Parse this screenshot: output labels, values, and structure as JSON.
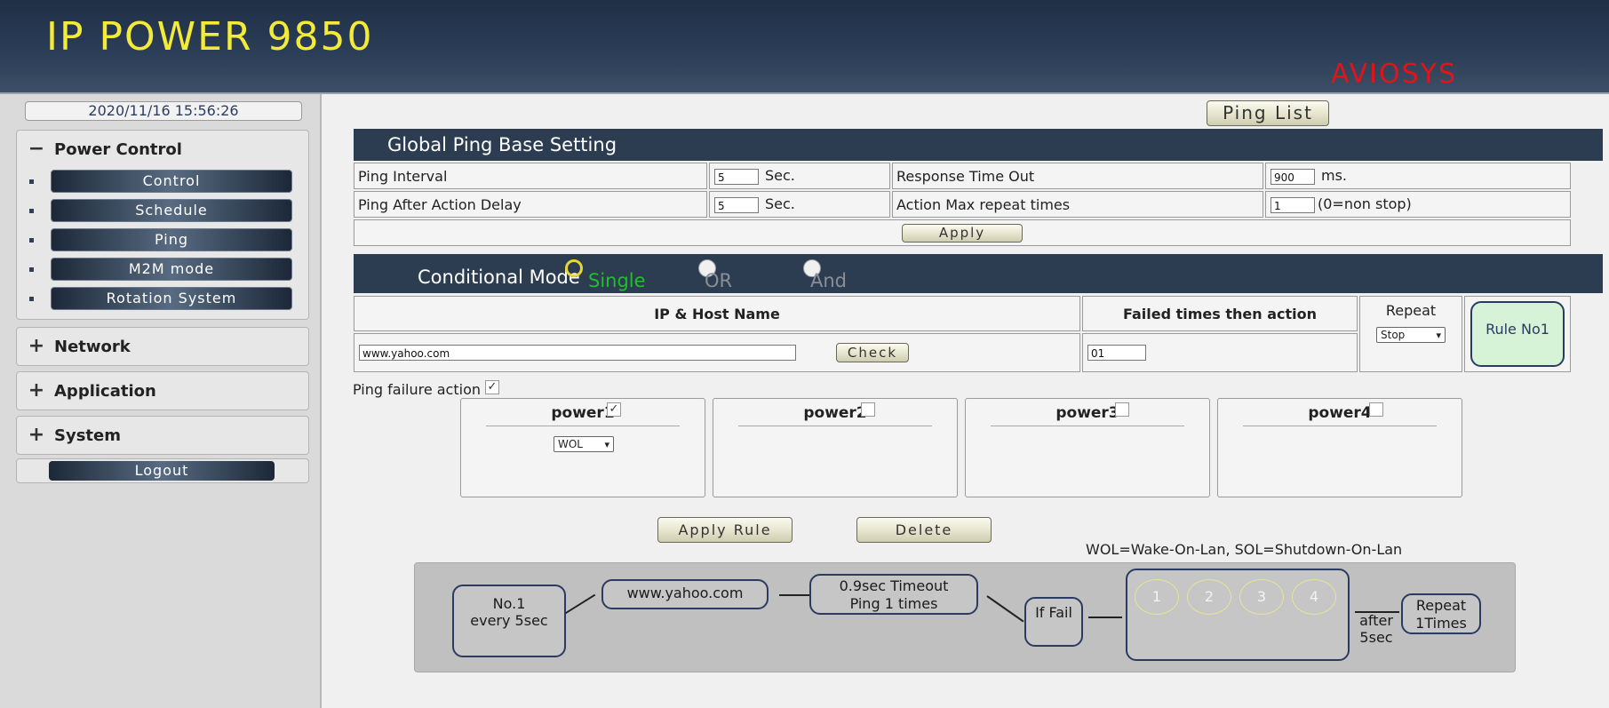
{
  "header": {
    "title": "IP POWER 9850",
    "brand": "AVIOSYS"
  },
  "sidebar": {
    "datetime": "2020/11/16 15:56:26",
    "power_control": {
      "sign": "−",
      "label": "Power Control",
      "items": [
        {
          "label": "Control"
        },
        {
          "label": "Schedule"
        },
        {
          "label": "Ping"
        },
        {
          "label": "M2M mode"
        },
        {
          "label": "Rotation System"
        }
      ]
    },
    "network": {
      "sign": "+",
      "label": "Network"
    },
    "application": {
      "sign": "+",
      "label": "Application"
    },
    "system": {
      "sign": "+",
      "label": "System"
    },
    "logout": "Logout"
  },
  "main": {
    "ping_list_button": "Ping List",
    "global": {
      "title": "Global Ping Base Setting",
      "ping_interval_label": "Ping Interval",
      "ping_interval_value": "5",
      "ping_interval_unit": "Sec.",
      "response_timeout_label": "Response Time Out",
      "response_timeout_value": "900",
      "response_timeout_unit": "ms.",
      "after_action_delay_label": "Ping After Action Delay",
      "after_action_delay_value": "5",
      "after_action_delay_unit": "Sec.",
      "max_repeat_label": "Action Max repeat times",
      "max_repeat_value": "1",
      "max_repeat_note": "(0=non stop)",
      "apply_button": "Apply"
    },
    "conditional": {
      "title": "Conditional Mode",
      "options": [
        {
          "label": "Single",
          "selected": true,
          "color": "#1fbf2a"
        },
        {
          "label": "OR",
          "selected": false,
          "color": "#8a8f96"
        },
        {
          "label": "And",
          "selected": false,
          "color": "#8a8f96"
        }
      ],
      "ip_header": "IP & Host Name",
      "failed_header": "Failed times then action",
      "repeat_header": "Repeat",
      "ip_value": "www.yahoo.com",
      "check_button": "Check",
      "failed_value": "01",
      "repeat_selected": "Stop",
      "rule_label": "Rule No1"
    },
    "failure_action": {
      "label": "Ping failure action",
      "checked": true,
      "powers": [
        {
          "label": "power1",
          "checked": true,
          "action": "WOL"
        },
        {
          "label": "power2",
          "checked": false
        },
        {
          "label": "power3",
          "checked": false
        },
        {
          "label": "power4",
          "checked": false
        }
      ]
    },
    "apply_rule_button": "Apply Rule",
    "delete_button": "Delete",
    "legend": "WOL=Wake-On-Lan, SOL=Shutdown-On-Lan",
    "flow": {
      "node1_line1": "No.1",
      "node1_line2": "every 5sec",
      "host": "www.yahoo.com",
      "timeout_line1": "0.9sec Timeout",
      "timeout_line2": "Ping 1 times",
      "if_fail": "If Fail",
      "outlets": [
        "1",
        "2",
        "3",
        "4"
      ],
      "after_line1": "after",
      "after_line2": "5sec",
      "repeat_line1": "Repeat",
      "repeat_line2": "1Times"
    }
  },
  "colors": {
    "header_title": "#f3ea3a",
    "brand": "#e0141a",
    "section_bar": "#2c3d52",
    "rule_box": "#d7f3d7"
  }
}
